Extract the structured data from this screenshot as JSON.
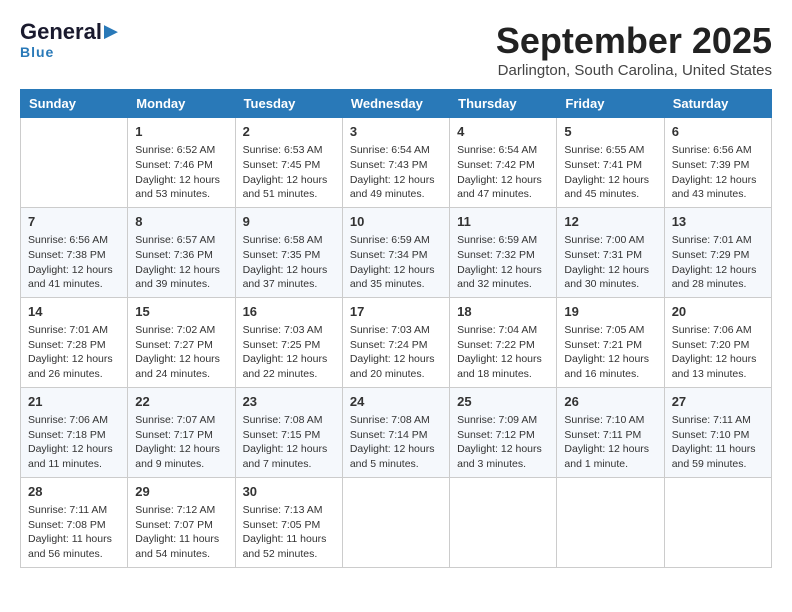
{
  "header": {
    "logo_line1": "General",
    "logo_line2": "Blue",
    "month": "September 2025",
    "location": "Darlington, South Carolina, United States"
  },
  "days_of_week": [
    "Sunday",
    "Monday",
    "Tuesday",
    "Wednesday",
    "Thursday",
    "Friday",
    "Saturday"
  ],
  "weeks": [
    [
      {
        "day": "",
        "info": ""
      },
      {
        "day": "1",
        "info": "Sunrise: 6:52 AM\nSunset: 7:46 PM\nDaylight: 12 hours\nand 53 minutes."
      },
      {
        "day": "2",
        "info": "Sunrise: 6:53 AM\nSunset: 7:45 PM\nDaylight: 12 hours\nand 51 minutes."
      },
      {
        "day": "3",
        "info": "Sunrise: 6:54 AM\nSunset: 7:43 PM\nDaylight: 12 hours\nand 49 minutes."
      },
      {
        "day": "4",
        "info": "Sunrise: 6:54 AM\nSunset: 7:42 PM\nDaylight: 12 hours\nand 47 minutes."
      },
      {
        "day": "5",
        "info": "Sunrise: 6:55 AM\nSunset: 7:41 PM\nDaylight: 12 hours\nand 45 minutes."
      },
      {
        "day": "6",
        "info": "Sunrise: 6:56 AM\nSunset: 7:39 PM\nDaylight: 12 hours\nand 43 minutes."
      }
    ],
    [
      {
        "day": "7",
        "info": "Sunrise: 6:56 AM\nSunset: 7:38 PM\nDaylight: 12 hours\nand 41 minutes."
      },
      {
        "day": "8",
        "info": "Sunrise: 6:57 AM\nSunset: 7:36 PM\nDaylight: 12 hours\nand 39 minutes."
      },
      {
        "day": "9",
        "info": "Sunrise: 6:58 AM\nSunset: 7:35 PM\nDaylight: 12 hours\nand 37 minutes."
      },
      {
        "day": "10",
        "info": "Sunrise: 6:59 AM\nSunset: 7:34 PM\nDaylight: 12 hours\nand 35 minutes."
      },
      {
        "day": "11",
        "info": "Sunrise: 6:59 AM\nSunset: 7:32 PM\nDaylight: 12 hours\nand 32 minutes."
      },
      {
        "day": "12",
        "info": "Sunrise: 7:00 AM\nSunset: 7:31 PM\nDaylight: 12 hours\nand 30 minutes."
      },
      {
        "day": "13",
        "info": "Sunrise: 7:01 AM\nSunset: 7:29 PM\nDaylight: 12 hours\nand 28 minutes."
      }
    ],
    [
      {
        "day": "14",
        "info": "Sunrise: 7:01 AM\nSunset: 7:28 PM\nDaylight: 12 hours\nand 26 minutes."
      },
      {
        "day": "15",
        "info": "Sunrise: 7:02 AM\nSunset: 7:27 PM\nDaylight: 12 hours\nand 24 minutes."
      },
      {
        "day": "16",
        "info": "Sunrise: 7:03 AM\nSunset: 7:25 PM\nDaylight: 12 hours\nand 22 minutes."
      },
      {
        "day": "17",
        "info": "Sunrise: 7:03 AM\nSunset: 7:24 PM\nDaylight: 12 hours\nand 20 minutes."
      },
      {
        "day": "18",
        "info": "Sunrise: 7:04 AM\nSunset: 7:22 PM\nDaylight: 12 hours\nand 18 minutes."
      },
      {
        "day": "19",
        "info": "Sunrise: 7:05 AM\nSunset: 7:21 PM\nDaylight: 12 hours\nand 16 minutes."
      },
      {
        "day": "20",
        "info": "Sunrise: 7:06 AM\nSunset: 7:20 PM\nDaylight: 12 hours\nand 13 minutes."
      }
    ],
    [
      {
        "day": "21",
        "info": "Sunrise: 7:06 AM\nSunset: 7:18 PM\nDaylight: 12 hours\nand 11 minutes."
      },
      {
        "day": "22",
        "info": "Sunrise: 7:07 AM\nSunset: 7:17 PM\nDaylight: 12 hours\nand 9 minutes."
      },
      {
        "day": "23",
        "info": "Sunrise: 7:08 AM\nSunset: 7:15 PM\nDaylight: 12 hours\nand 7 minutes."
      },
      {
        "day": "24",
        "info": "Sunrise: 7:08 AM\nSunset: 7:14 PM\nDaylight: 12 hours\nand 5 minutes."
      },
      {
        "day": "25",
        "info": "Sunrise: 7:09 AM\nSunset: 7:12 PM\nDaylight: 12 hours\nand 3 minutes."
      },
      {
        "day": "26",
        "info": "Sunrise: 7:10 AM\nSunset: 7:11 PM\nDaylight: 12 hours\nand 1 minute."
      },
      {
        "day": "27",
        "info": "Sunrise: 7:11 AM\nSunset: 7:10 PM\nDaylight: 11 hours\nand 59 minutes."
      }
    ],
    [
      {
        "day": "28",
        "info": "Sunrise: 7:11 AM\nSunset: 7:08 PM\nDaylight: 11 hours\nand 56 minutes."
      },
      {
        "day": "29",
        "info": "Sunrise: 7:12 AM\nSunset: 7:07 PM\nDaylight: 11 hours\nand 54 minutes."
      },
      {
        "day": "30",
        "info": "Sunrise: 7:13 AM\nSunset: 7:05 PM\nDaylight: 11 hours\nand 52 minutes."
      },
      {
        "day": "",
        "info": ""
      },
      {
        "day": "",
        "info": ""
      },
      {
        "day": "",
        "info": ""
      },
      {
        "day": "",
        "info": ""
      }
    ]
  ]
}
